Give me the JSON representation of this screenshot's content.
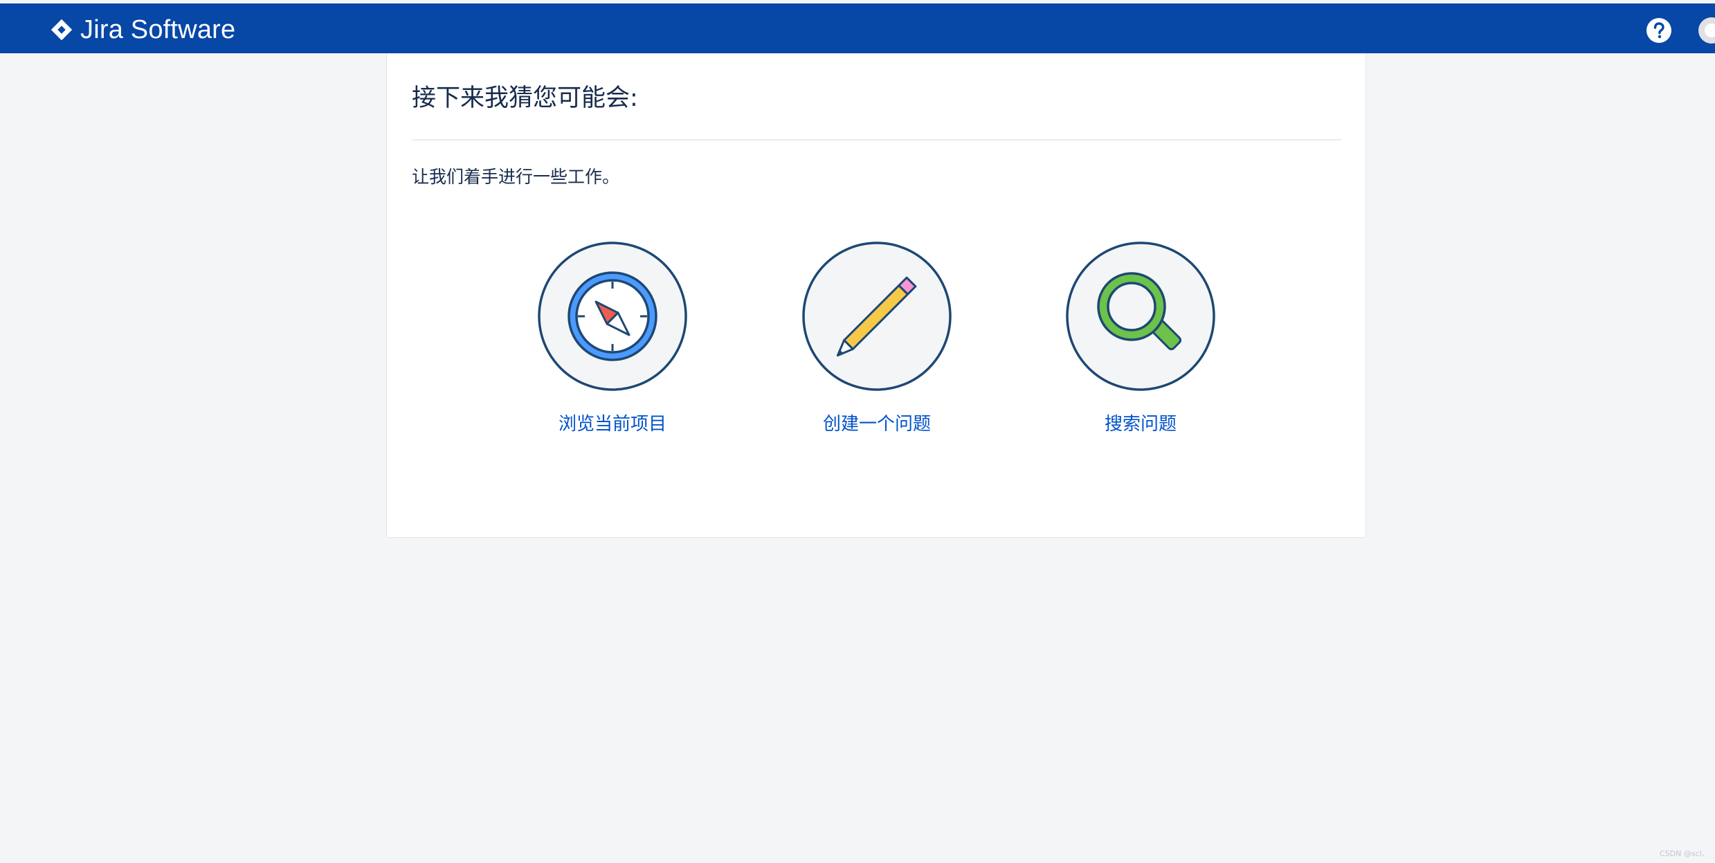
{
  "header": {
    "logo_text": "Jira Software",
    "logo_icon": "jira-diamond-icon",
    "help_icon": "help-icon",
    "avatar_icon": "user-avatar-icon",
    "bg_color": "#0747a6"
  },
  "main": {
    "title": "接下来我猜您可能会:",
    "subtitle": "让我们着手进行一些工作。",
    "actions": [
      {
        "label": "浏览当前项目",
        "icon": "compass-icon"
      },
      {
        "label": "创建一个问题",
        "icon": "pencil-icon"
      },
      {
        "label": "搜索问题",
        "icon": "magnifier-icon"
      }
    ],
    "link_color": "#0052cc"
  },
  "watermark": "CSDN @scl、"
}
